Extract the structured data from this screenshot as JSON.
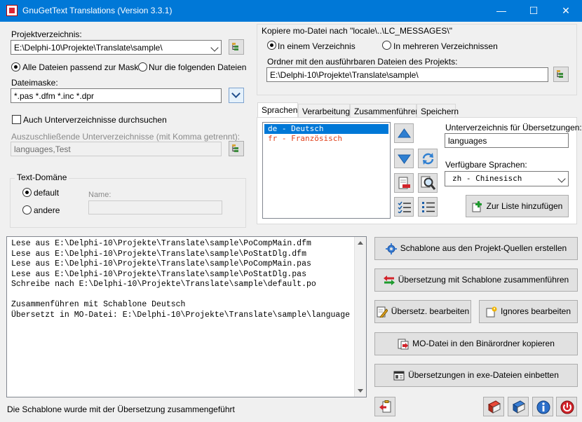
{
  "window": {
    "title": "GnuGetText Translations (Version 3.3.1)",
    "minimize": "—",
    "maximize": "☐",
    "close": "✕"
  },
  "project": {
    "dir_label": "Projektverzeichnis:",
    "dir_value": "E:\\Delphi-10\\Projekte\\Translate\\sample\\",
    "radio_all": "Alle Dateien passend zur Maske",
    "radio_selected": "Nur die folgenden Dateien",
    "mask_label": "Dateimaske:",
    "mask_value": "*.pas *.dfm *.inc *.dpr",
    "subdirs_label": "Auch Unterverzeichnisse durchsuchen",
    "exclude_label": "Auszuschließende Unterverzeichnisse (mit Komma getrennt):",
    "exclude_value": "languages,Test"
  },
  "domain": {
    "group_title": "Text-Domäne",
    "opt_default": "default",
    "opt_other": "andere",
    "name_label": "Name:",
    "name_value": ""
  },
  "mo_copy": {
    "group_title": "Kopiere mo-Datei nach \"locale\\..\\LC_MESSAGES\\\"",
    "opt_one": "In einem Verzeichnis",
    "opt_many": "In mehreren Verzeichnissen",
    "exe_dir_label": "Ordner mit den ausführbaren Dateien des Projekts:",
    "exe_dir_value": "E:\\Delphi-10\\Projekte\\Translate\\sample\\"
  },
  "tabs": [
    "Sprachen",
    "Verarbeitung",
    "Zusammenführen",
    "Speichern"
  ],
  "languages": {
    "items": [
      {
        "text": "de - Deutsch",
        "selected": true
      },
      {
        "text": "fr - Französisch",
        "selected": false
      }
    ],
    "subdir_label": "Unterverzeichnis für Übersetzungen:",
    "subdir_value": "languages",
    "available_label": "Verfügbare Sprachen:",
    "available_value": "zh - Chinesisch",
    "add_button": "Zur Liste hinzufügen"
  },
  "log": {
    "lines": [
      "Lese aus E:\\Delphi-10\\Projekte\\Translate\\sample\\PoCompMain.dfm",
      "Lese aus E:\\Delphi-10\\Projekte\\Translate\\sample\\PoStatDlg.dfm",
      "Lese aus E:\\Delphi-10\\Projekte\\Translate\\sample\\PoCompMain.pas",
      "Lese aus E:\\Delphi-10\\Projekte\\Translate\\sample\\PoStatDlg.pas",
      "Schreibe nach E:\\Delphi-10\\Projekte\\Translate\\sample\\default.po",
      "",
      "Zusammenführen mit Schablone Deutsch",
      "Übersetzt in MO-Datei: E:\\Delphi-10\\Projekte\\Translate\\sample\\language"
    ]
  },
  "actions": {
    "create_template": "Schablone aus den Projekt-Quellen erstellen",
    "merge": "Übersetzung mit Schablone zusammenführen",
    "edit": "Übersetz. bearbeiten",
    "ignores": "Ignores bearbeiten",
    "copy_mo": "MO-Datei in den Binärordner kopieren",
    "embed": "Übersetzungen in exe-Dateien einbetten"
  },
  "status": {
    "text": "Die Schablone wurde mit der Übersetzung zusammengeführt"
  },
  "colors": {
    "titlebar": "#0078d7",
    "selection": "#0078d7",
    "french_text": "#e0401a"
  }
}
